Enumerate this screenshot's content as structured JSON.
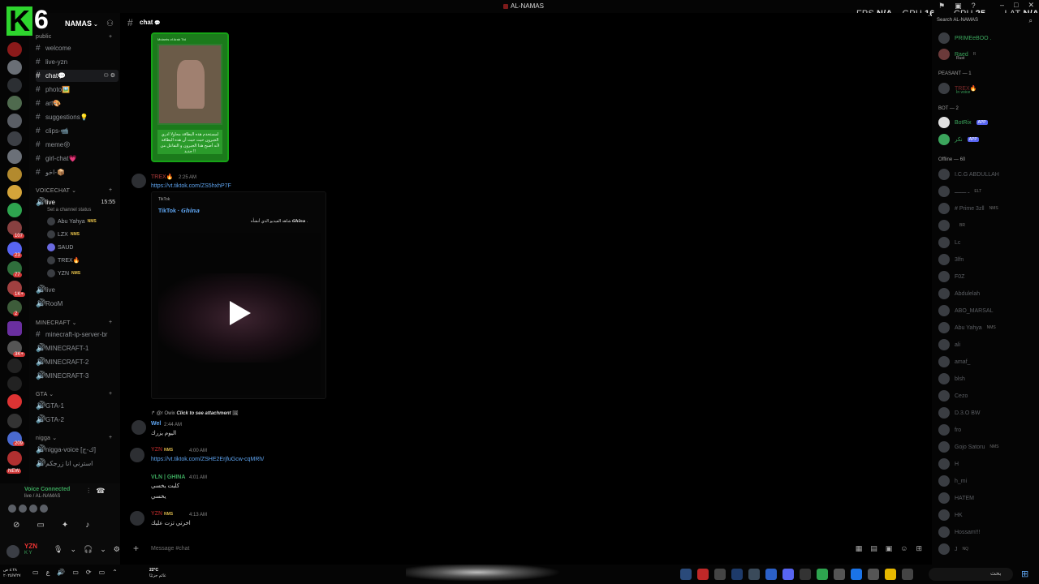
{
  "window": {
    "title": "AL-NAMAS"
  },
  "perf": {
    "fps_label": "FPS",
    "fps": "N/A",
    "gpu_label": "GPU",
    "gpu": "16 %",
    "cpu_label": "CPU",
    "cpu": "25 %",
    "lat_label": "LAT",
    "lat": "N/A"
  },
  "overlay_logo": {
    "k": "K",
    "n": "6"
  },
  "guild": {
    "name": "NAMAS"
  },
  "server_badges": [
    "107",
    "23",
    "77",
    "1K+",
    "2",
    "3K+",
    "209",
    "NEW"
  ],
  "sidebar": {
    "cat_public": "public",
    "channels": [
      {
        "name": "welcome"
      },
      {
        "name": "live-yzn"
      },
      {
        "name": "chat💬"
      },
      {
        "name": "photo🖼️"
      },
      {
        "name": "art🎨"
      },
      {
        "name": "suggestions💡"
      },
      {
        "name": "clips-📹"
      },
      {
        "name": "meme😝"
      },
      {
        "name": "girl-chat💗"
      },
      {
        "name": "اخو-📦"
      }
    ],
    "cat_voice": "VOICECHAT",
    "voice_live": {
      "name": "live",
      "time": "15:55",
      "status": "Set a channel status"
    },
    "voice_users": [
      {
        "name": "Abu Yahya",
        "tag": "NMS"
      },
      {
        "name": "LZX",
        "tag": "NMS"
      },
      {
        "name": "SAUD",
        "tag": ""
      },
      {
        "name": "TREX🔥",
        "tag": ""
      },
      {
        "name": "YZN",
        "tag": "NMS"
      }
    ],
    "voice_more": [
      {
        "name": "live"
      },
      {
        "name": "RooM"
      }
    ],
    "cat_minecraft": "MINECRAFT",
    "minecraft": [
      {
        "name": "minecraft-ip-server-br"
      },
      {
        "name": "MINECRAFT-1"
      },
      {
        "name": "MINECRAFT-2"
      },
      {
        "name": "MINECRAFT-3"
      }
    ],
    "cat_gta": "GTA",
    "gta": [
      {
        "name": "GTA-1"
      },
      {
        "name": "GTA-2"
      }
    ],
    "cat_nigga": "nigga",
    "nigga": [
      {
        "name": "nigga-voice [ك-ج]"
      },
      {
        "name": "استرني انا زرجكم"
      }
    ]
  },
  "voice_panel": {
    "status": "Voice Connected",
    "sub": "live / AL-NAMAS"
  },
  "user": {
    "name": "YZN",
    "status": "K Y"
  },
  "chat": {
    "channel": "chat",
    "card_caption": "لمستخدم هذه البطاقة محاولا ادري الجيرون حيث حيث أن هذه البطاقة لأنه أصبح هذا الجيرون و التفاعل من جديد !!",
    "card_header": "Mutants of Arab Ttd",
    "messages": [
      {
        "author": "TREX🔥",
        "time": "2:25 AM",
        "link": "https://vt.tiktok.com/ZS5hxhP7F"
      },
      {
        "author": "Wel",
        "time": "2:44 AM",
        "text": "اليوم يزرك"
      },
      {
        "author": "YZN",
        "tag": "NMS",
        "time": "4:00 AM",
        "link": "https://vt.tiktok.com/ZSHE2ErjfuGcw-cqMRh/"
      },
      {
        "author": "VLN | GHINA",
        "time": "4:01 AM",
        "text1": "كلبت يخسي",
        "text2": "يخسي"
      },
      {
        "author": "YZN",
        "tag": "NMS",
        "time": "4:13 AM",
        "text": "اخرتي تزت عليك"
      }
    ],
    "embed": {
      "provider": "TikTok",
      "title": "TikTok · 𝙂𝙝𝙞𝙣𝙖",
      "desc": "شاهد الفيديو الذي أنشأه 𝙂𝙝𝙞𝙣𝙖 ."
    },
    "reply": {
      "who": "@r Owix",
      "text": "Click to see attachment"
    },
    "composer_placeholder": "Message #chat"
  },
  "members": {
    "search_placeholder": "Search AL-NAMAS",
    "top": [
      {
        "name": "PRIMEeBOO ."
      },
      {
        "name": "Raed",
        "tag": "R",
        "sub": "Rust"
      }
    ],
    "peasant_header": "PEASANT — 1",
    "peasant": [
      {
        "name": "TREX🔥",
        "sub": "In voice"
      }
    ],
    "bot_header": "BOT — 2",
    "bots": [
      {
        "name": "BotRix",
        "badge": "APP"
      },
      {
        "name": "نكر",
        "badge": "APP"
      }
    ],
    "offline_header": "Offline — 60",
    "offline": [
      {
        "name": "I.C.G ABDULLAH",
        "tag": ""
      },
      {
        "name": "ـ ـــــــ",
        "tag": "ELT"
      },
      {
        "name": "# Prime 3zll",
        "tag": "NMS"
      },
      {
        "name": "",
        "tag": "BR"
      },
      {
        "name": "Lc",
        "tag": ""
      },
      {
        "name": "3lfn",
        "tag": ""
      },
      {
        "name": "F0Z",
        "tag": ""
      },
      {
        "name": "Abdulelah",
        "tag": ""
      },
      {
        "name": "ABO_MARSAL",
        "tag": ""
      },
      {
        "name": "Abu Yahya",
        "tag": "NMS"
      },
      {
        "name": "ali",
        "tag": ""
      },
      {
        "name": "amaf_",
        "tag": ""
      },
      {
        "name": "blsh",
        "tag": ""
      },
      {
        "name": "Cezo",
        "tag": ""
      },
      {
        "name": "D.3.O BW",
        "tag": ""
      },
      {
        "name": "fro",
        "tag": ""
      },
      {
        "name": "Gojo Satoru",
        "tag": "NMS"
      },
      {
        "name": "H",
        "tag": ""
      },
      {
        "name": "h_mi",
        "tag": ""
      },
      {
        "name": "HATEM",
        "tag": ""
      },
      {
        "name": "HK",
        "tag": ""
      },
      {
        "name": "Hossam!!!",
        "tag": ""
      },
      {
        "name": "J",
        "tag": "NQ"
      }
    ]
  },
  "taskbar": {
    "time": "٤:٢٨ ص",
    "date": "٢٠٢٥/٧/٢٧",
    "temp": "22°C",
    "weather": "غائم جزئيًا",
    "search": "بحث"
  }
}
